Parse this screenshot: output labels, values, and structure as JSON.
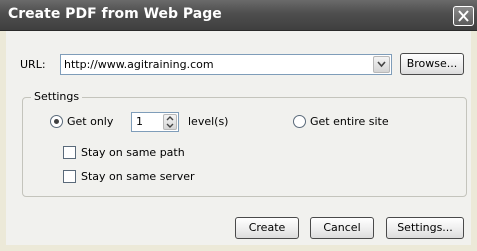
{
  "window": {
    "title": "Create PDF from Web Page"
  },
  "url": {
    "label": "URL:",
    "value": "http://www.agitraining.com",
    "browse_label": "Browse..."
  },
  "settings": {
    "group_label": "Settings",
    "get_only_label": "Get only",
    "levels_value": "1",
    "levels_label": "level(s)",
    "get_entire_site_label": "Get entire site",
    "selected_option": "get_only",
    "stay_same_path_label": "Stay on same path",
    "stay_same_path_checked": false,
    "stay_same_server_label": "Stay on same server",
    "stay_same_server_checked": false
  },
  "buttons": {
    "create": "Create",
    "cancel": "Cancel",
    "settings": "Settings..."
  },
  "icons": {
    "close": "close-icon",
    "dropdown": "chevron-down-icon",
    "spin_up": "spin-up-icon",
    "spin_down": "spin-down-icon"
  }
}
